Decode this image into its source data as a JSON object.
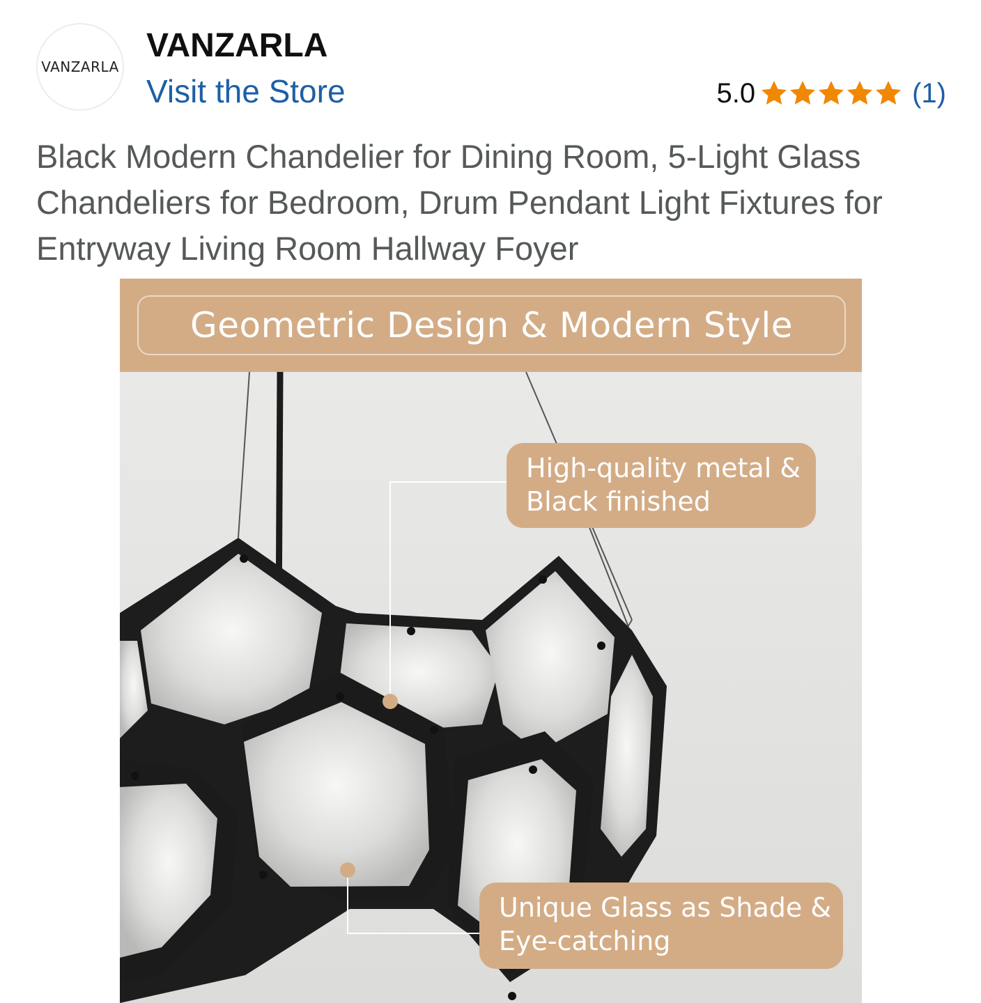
{
  "header": {
    "logo_text": "VANZARLA",
    "brand": "VANZARLA",
    "store_link": "Visit the Store",
    "rating": {
      "value_text": "5.0",
      "stars": 5,
      "max_stars": 5,
      "count_text": "(1)",
      "star_color": "#f08804"
    }
  },
  "product": {
    "title": "Black Modern Chandelier for Dining Room, 5-Light Glass Chandeliers for Bedroom, Drum Pendant Light Fixtures for Entryway Living Room Hallway Foyer"
  },
  "image": {
    "banner": "Geometric Design & Modern Style",
    "callouts": [
      {
        "line1": "High-quality metal &",
        "line2": "Black finished"
      },
      {
        "line1": "Unique Glass as Shade &",
        "line2": "Eye-catching"
      }
    ],
    "accent_color": "#d3ac86"
  }
}
